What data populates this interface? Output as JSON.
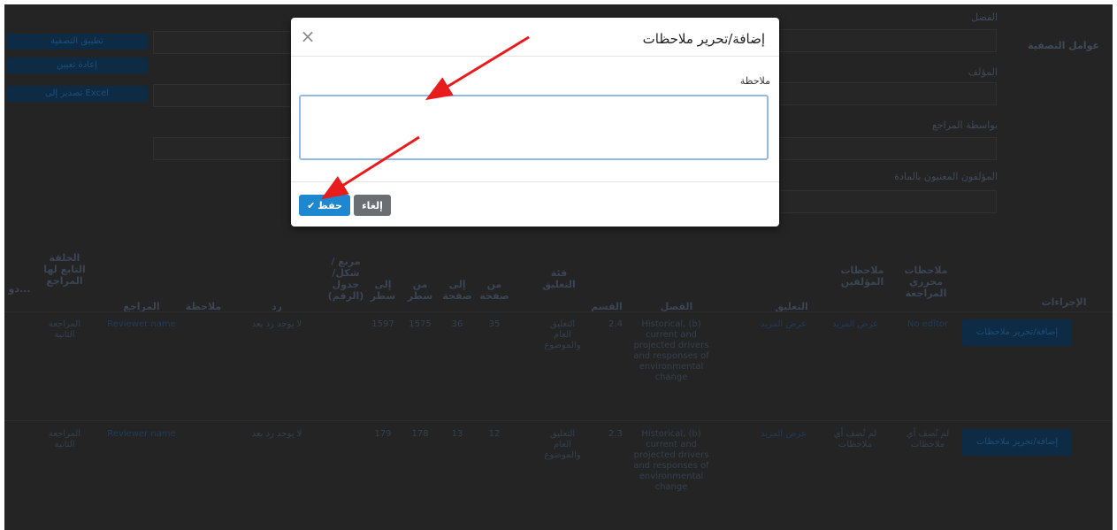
{
  "modal": {
    "title": "إضافة/تحرير ملاحظات",
    "close": "×",
    "label": "ملاحظة",
    "textarea_value": "",
    "save_label": "حفظ",
    "save_icon": "✔",
    "cancel_label": "إلغاء"
  },
  "background": {
    "sidebar_title": "عوامل التصفية",
    "filters": {
      "chapter": "الفصل",
      "author": "المؤلف",
      "reviewer": "بواسطة المراجع",
      "all_authors": "المؤلفون المعنيون بالمادة"
    },
    "left_buttons": [
      "تطبيق التصفية",
      "إعادة تعيين",
      "تصدير إلى Excel"
    ],
    "table": {
      "headers": [
        "الإجراءات",
        "ملاحظات محرري المراجعة",
        "ملاحظات المؤلفين",
        "التعليق",
        "الفصل",
        "القسم",
        "فئة التعليق",
        "من صفحة",
        "إلى صفحة",
        "من سطر",
        "إلى سطر",
        "مربع / شكل/ جدول (الرقم)",
        "رد",
        "ملاحظة",
        "المراجع",
        "الحلقة التابع لها المراجع",
        "دو..."
      ],
      "rows": [
        {
          "action": "إضافة/تحرير ملاحظات",
          "editor_note": "No editor",
          "author_note": "عرض المزيد",
          "comment": "عرض المزيد",
          "chapter": "Historical, (b) current and projected drivers and responses of environmental change",
          "section": "2.4",
          "category": "التعليق العام والموضوع",
          "from_page": "35",
          "to_page": "36",
          "from_line": "1575",
          "to_line": "1597",
          "reply": "لا يوجد رد بعد",
          "reviewer": "Reviewer name",
          "round": "المراجعة الثانية"
        },
        {
          "action": "إضافة/تحرير ملاحظات",
          "editor_note": "لم تُضف أي ملاحظات",
          "author_note": "لم تُضف أي ملاحظات",
          "comment": "عرض المزيد",
          "chapter": "Historical, (b) current and projected drivers and responses of environmental change",
          "section": "2.3",
          "category": "التعليق العام والموضوع",
          "from_page": "12",
          "to_page": "13",
          "from_line": "178",
          "to_line": "179",
          "reply": "لا يوجد رد بعد",
          "reviewer": "Reviewer name",
          "round": "المراجعة الثانية"
        }
      ]
    }
  },
  "colors": {
    "overlay": "#242424",
    "save_button": "#1d87cf",
    "cancel_button": "#6b6e73",
    "arrow": "#e81c1c",
    "textarea_focus": "#93b8e8"
  }
}
